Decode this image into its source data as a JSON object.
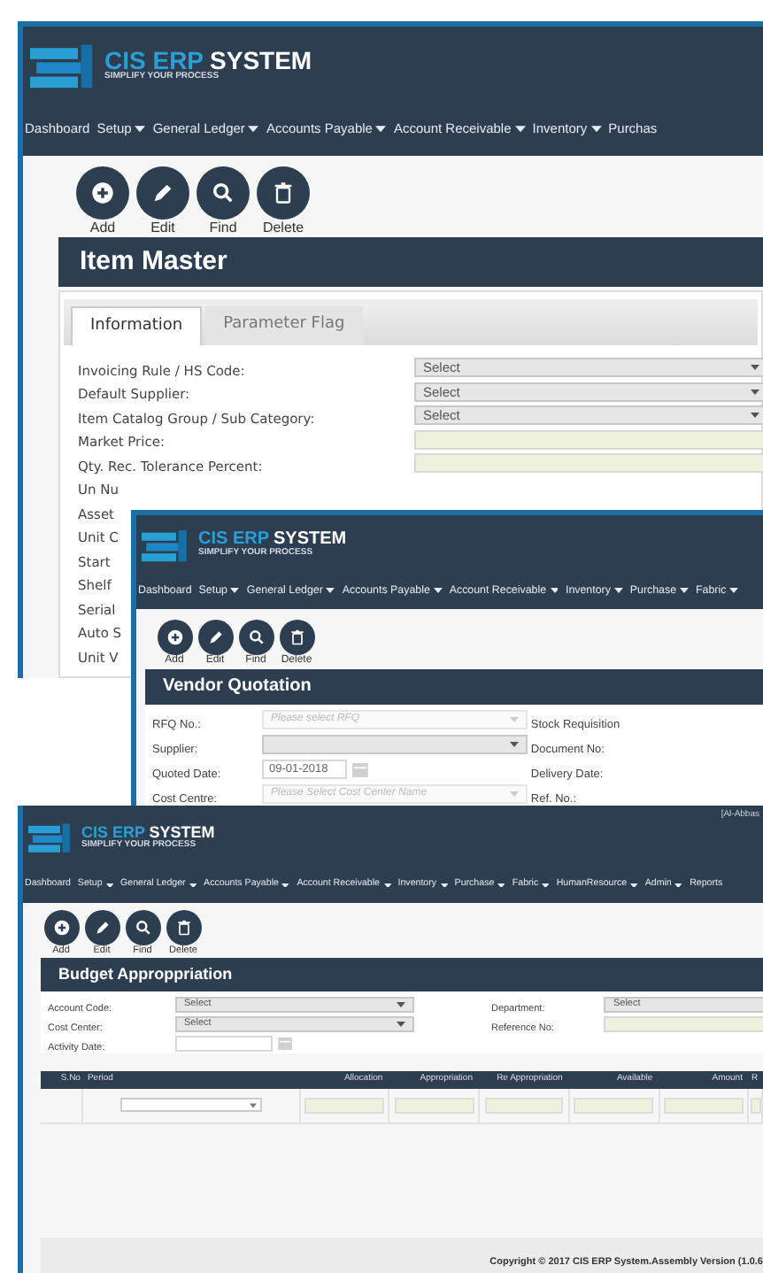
{
  "windows": [
    {
      "brand": {
        "primary": "CIS ERP",
        "secondary": "SYSTEM",
        "tagline": "SIMPLIFY YOUR PROCESS"
      },
      "nav": [
        {
          "label": "Dashboard",
          "dropdown": false
        },
        {
          "label": "Setup",
          "dropdown": true
        },
        {
          "label": "General Ledger",
          "dropdown": true
        },
        {
          "label": "Accounts Payable",
          "dropdown": true
        },
        {
          "label": "Account Receivable",
          "dropdown": true
        },
        {
          "label": "Inventory",
          "dropdown": true
        },
        {
          "label": "Purchas",
          "dropdown": false
        }
      ],
      "toolbar": [
        "Add",
        "Edit",
        "Find",
        "Delete"
      ],
      "title": "Item Master",
      "tabs": [
        {
          "label": "Information",
          "selected": true
        },
        {
          "label": "Parameter Flag",
          "selected": false
        }
      ],
      "fields": [
        {
          "label": "Invoicing Rule / HS Code:",
          "kind": "select",
          "value": "Select"
        },
        {
          "label": "Default Supplier:",
          "kind": "select",
          "value": "Select"
        },
        {
          "label": "Item Catalog Group / Sub Category:",
          "kind": "select",
          "value": "Select"
        },
        {
          "label": "Market Price:",
          "kind": "input"
        },
        {
          "label": "Qty. Rec. Tolerance Percent:",
          "kind": "input"
        },
        {
          "label": "Un Nu",
          "kind": "none"
        },
        {
          "label": "Asset",
          "kind": "none"
        },
        {
          "label": "Unit C",
          "kind": "none"
        },
        {
          "label": "Start",
          "kind": "none"
        },
        {
          "label": "Shelf",
          "kind": "none"
        },
        {
          "label": "Serial",
          "kind": "none"
        },
        {
          "label": "Auto S",
          "kind": "none"
        },
        {
          "label": "Unit V",
          "kind": "none"
        }
      ]
    },
    {
      "brand": {
        "primary": "CIS ERP",
        "secondary": "SYSTEM",
        "tagline": "SIMPLIFY YOUR PROCESS"
      },
      "nav": [
        {
          "label": "Dashboard",
          "dropdown": false
        },
        {
          "label": "Setup",
          "dropdown": true
        },
        {
          "label": "General Ledger",
          "dropdown": true
        },
        {
          "label": "Accounts Payable",
          "dropdown": true
        },
        {
          "label": "Account Receivable",
          "dropdown": true
        },
        {
          "label": "Inventory",
          "dropdown": true
        },
        {
          "label": "Purchase",
          "dropdown": true
        },
        {
          "label": "Fabric",
          "dropdown": true
        }
      ],
      "toolbar": [
        "Add",
        "Edit",
        "Find",
        "Delete"
      ],
      "title": "Vendor Quotation",
      "fields": [
        {
          "label": "RFQ No.:",
          "kind": "select",
          "placeholder": "Please select RFQ",
          "disabled": true
        },
        {
          "label": "Supplier:",
          "kind": "select",
          "disabled": false
        },
        {
          "label": "Quoted Date:",
          "kind": "date",
          "value": "09-01-2018"
        },
        {
          "label": "Cost Centre:",
          "kind": "select",
          "placeholder": "Please Select Cost Center Name",
          "disabled": true
        }
      ],
      "right_fields": [
        {
          "label": "Stock Requisition",
          "kind": "none"
        },
        {
          "label": "Document No:",
          "kind": "none"
        },
        {
          "label": "Delivery Date:",
          "kind": "none"
        },
        {
          "label": "Ref. No.:",
          "kind": "none"
        }
      ]
    },
    {
      "brand": {
        "primary": "CIS ERP",
        "secondary": "SYSTEM",
        "tagline": "SIMPLIFY YOUR PROCESS"
      },
      "user": "[Al-Abbas",
      "nav": [
        {
          "label": "Dashboard",
          "dropdown": false
        },
        {
          "label": "Setup",
          "dropdown": true
        },
        {
          "label": "General Ledger",
          "dropdown": true
        },
        {
          "label": "Accounts Payable",
          "dropdown": true
        },
        {
          "label": "Account Receivable",
          "dropdown": true
        },
        {
          "label": "Inventory",
          "dropdown": true
        },
        {
          "label": "Purchase",
          "dropdown": true
        },
        {
          "label": "Fabric",
          "dropdown": true
        },
        {
          "label": "HumanResource",
          "dropdown": true
        },
        {
          "label": "Admin",
          "dropdown": true
        },
        {
          "label": "Reports",
          "dropdown": false
        }
      ],
      "toolbar": [
        "Add",
        "Edit",
        "Find",
        "Delete"
      ],
      "title": "Budget Approppriation",
      "fields": [
        {
          "label": "Account Code:",
          "kind": "select",
          "value": "Select"
        },
        {
          "label": "Cost Center:",
          "kind": "select",
          "value": "Select"
        },
        {
          "label": "Activity Date:",
          "kind": "date"
        }
      ],
      "right_fields": [
        {
          "label": "Department:",
          "kind": "select",
          "value": "Select"
        },
        {
          "label": "Reference No:",
          "kind": "input"
        }
      ],
      "table": {
        "columns": [
          "S.No",
          "Period",
          "Allocation",
          "Appropriation",
          "Re Appropriation",
          "Available",
          "Amount",
          "R"
        ],
        "rows": [
          {
            "cells": [
              {
                "kind": "none"
              },
              {
                "kind": "select"
              },
              {
                "kind": "input"
              },
              {
                "kind": "input"
              },
              {
                "kind": "input"
              },
              {
                "kind": "input"
              },
              {
                "kind": "input"
              },
              {
                "kind": "input"
              }
            ]
          }
        ]
      },
      "footer": "Copyright © 2017 CIS ERP System.Assembly Version (1.0.6"
    }
  ]
}
